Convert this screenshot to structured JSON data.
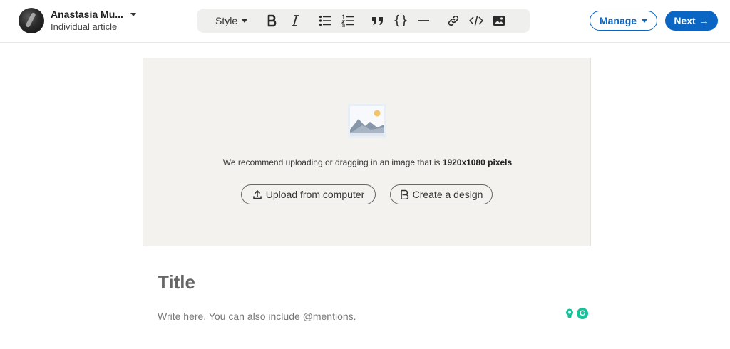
{
  "author": {
    "name": "Anastasia Mu...",
    "subtitle": "Individual article"
  },
  "toolbar": {
    "style_label": "Style",
    "buttons": [
      {
        "icon": "bold-icon"
      },
      {
        "icon": "italic-icon"
      },
      {
        "icon": "bulleted-list-icon"
      },
      {
        "icon": "numbered-list-icon"
      },
      {
        "icon": "quote-icon"
      },
      {
        "icon": "code-block-icon"
      },
      {
        "icon": "divider-icon"
      },
      {
        "icon": "link-icon"
      },
      {
        "icon": "embed-icon"
      },
      {
        "icon": "image-icon"
      }
    ]
  },
  "actions": {
    "manage_label": "Manage",
    "next_label": "Next"
  },
  "cover": {
    "recommend_text": "We recommend uploading or dragging in an image that is ",
    "recommend_size": "1920x1080 pixels",
    "upload_label": "Upload from computer",
    "design_label": "Create a design"
  },
  "editor": {
    "title_placeholder": "Title",
    "body_placeholder": "Write here. You can also include @mentions."
  },
  "assistant": {
    "g_letter": "G"
  },
  "colors": {
    "brand": "#0a66c2",
    "cover_bg": "#f3f2ef",
    "toolbar_bg": "#efefed",
    "grammarly": "#15c39a"
  }
}
